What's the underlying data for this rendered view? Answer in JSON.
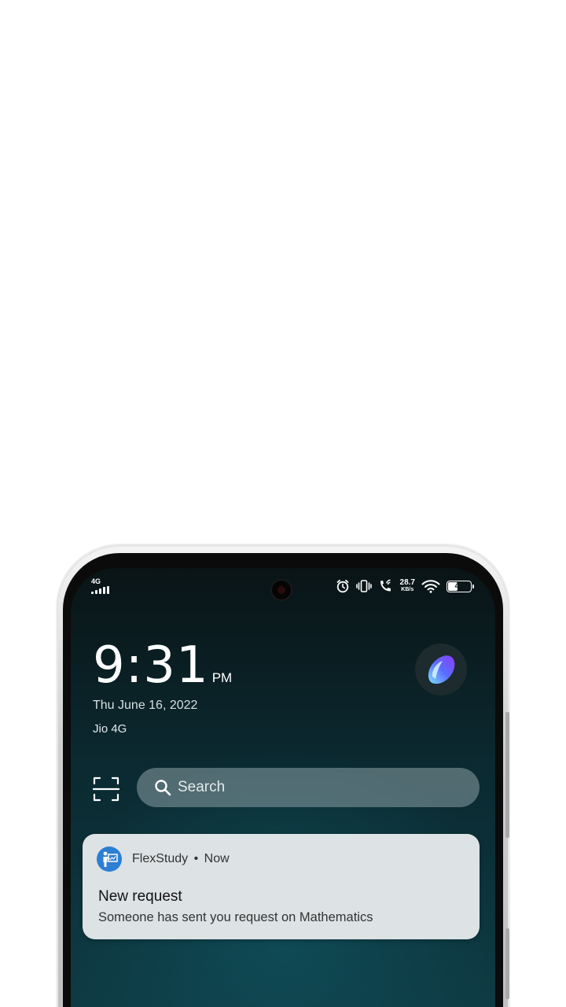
{
  "status_bar": {
    "network_type": "4G",
    "signal_icon": "signal-bars-icon",
    "icons": [
      "alarm-icon",
      "vibrate-icon",
      "wifi-calling-icon",
      "wifi-icon"
    ],
    "speed_value": "28.7",
    "speed_unit": "KB/s",
    "battery_percent": "47",
    "battery_level": 0.47
  },
  "lockscreen": {
    "time": "9:31",
    "ampm": "PM",
    "date": "Thu June 16, 2022",
    "carrier": "Jio 4G",
    "assistant_icon": "assistant-orb-icon"
  },
  "search": {
    "scan_icon": "scan-icon",
    "search_icon": "search-icon",
    "placeholder": "Search"
  },
  "notification": {
    "app_name": "FlexStudy",
    "separator": "•",
    "time": "Now",
    "title": "New request",
    "body": "Someone has sent you request on Mathematics",
    "app_icon": "teacher-icon",
    "accent_color": "#2c7fd3"
  }
}
